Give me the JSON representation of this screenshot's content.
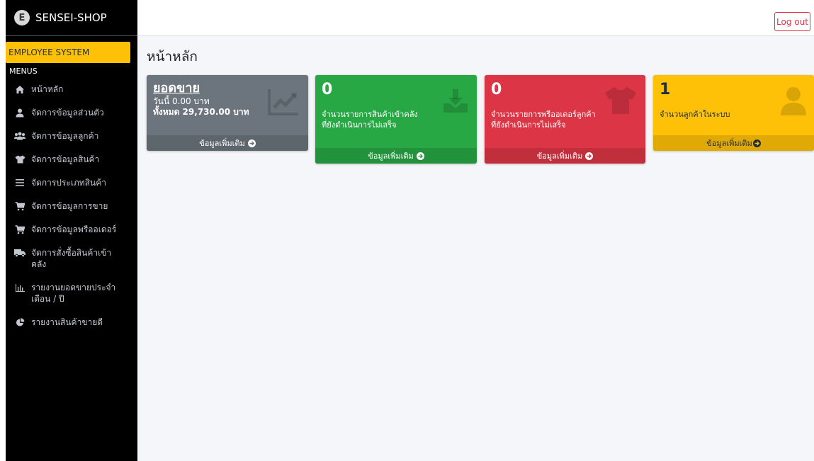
{
  "brand": {
    "logo_letter": "E",
    "name": "SENSEI-SHOP"
  },
  "sidebar": {
    "section_label": "EMPLOYEE SYSTEM",
    "menus_header": "MENUS",
    "items": [
      {
        "label": "หน้าหลัก",
        "icon": "home-icon"
      },
      {
        "label": "จัดการข้อมูลส่วนตัว",
        "icon": "user-icon"
      },
      {
        "label": "จัดการข้อมูลลูกค้า",
        "icon": "users-icon"
      },
      {
        "label": "จัดการข้อมูลสินค้า",
        "icon": "tshirt-icon"
      },
      {
        "label": "จัดการประเภทสินค้า",
        "icon": "list-icon"
      },
      {
        "label": "จัดการข้อมูลการขาย",
        "icon": "cart-icon"
      },
      {
        "label": "จัดการข้อมูลพรีออเดอร์",
        "icon": "cart-icon"
      },
      {
        "label": "จัดการสั่งซื้อสินค้าเข้าคลัง",
        "icon": "truck-icon"
      },
      {
        "label": "รายงานยอดขายประจำเดือน / ปี",
        "icon": "bar-chart-icon"
      },
      {
        "label": "รายงานสินค้าขายดี",
        "icon": "pie-chart-icon"
      }
    ]
  },
  "topbar": {
    "logout_label": "Log out"
  },
  "page": {
    "title": "หน้าหลัก"
  },
  "cards": {
    "sales": {
      "title": "ยอดขาย",
      "today": "วันนี้ 0.00 บาท",
      "total": "ทั้งหมด 29,730.00 บาท",
      "more": "ข้อมูลเพิ่มเติม",
      "color": "#6c757d",
      "icon": "chart-line-icon"
    },
    "stock_in": {
      "count": "0",
      "desc_line1": "จำนวนรายการสินค้าเข้าคลัง",
      "desc_line2": "ที่ยังดำเนินการไม่เสร็จ",
      "more": "ข้อมูลเพิ่มเติม",
      "color": "#28a745",
      "icon": "download-icon"
    },
    "preorder": {
      "count": "0",
      "desc_line1": "จำนวนรายการพรีออเดอร์ลูกค้า",
      "desc_line2": "ที่ยังดำเนินการไม่เสร็จ",
      "more": "ข้อมูลเพิ่มเติม",
      "color": "#dc3545",
      "icon": "tshirt-icon"
    },
    "customers": {
      "count": "1",
      "desc": "จำนวนลูกค้าในระบบ",
      "more": "ข้อมูลเพิ่มเติม",
      "color": "#ffc107",
      "icon": "user-icon"
    }
  }
}
